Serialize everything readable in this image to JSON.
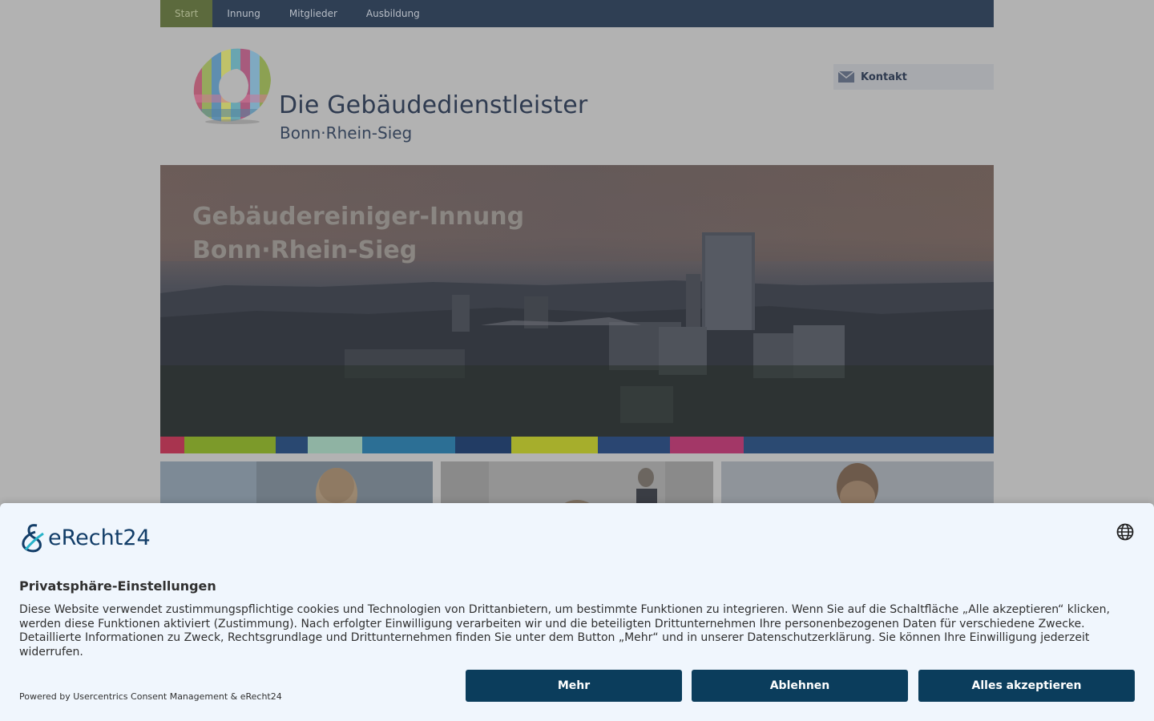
{
  "nav": {
    "items": [
      {
        "label": "Start",
        "active": true
      },
      {
        "label": "Innung"
      },
      {
        "label": "Mitglieder"
      },
      {
        "label": "Ausbildung"
      }
    ]
  },
  "header": {
    "title": "Die Gebäudedienstleister",
    "subtitle": "Bonn·Rhein-Sieg",
    "contact_label": "Kontakt",
    "contact_icon": "mail-icon"
  },
  "hero": {
    "title_line1": "Gebäudereiniger-Innung",
    "title_line2": "Bonn·Rhein-Sieg",
    "stripe_colors": [
      "#a8344f",
      "#7c9a2a",
      "#294871",
      "#8fb3a3",
      "#2c6f95",
      "#223c64",
      "#a6ae2c",
      "#2a4672",
      "#a33767",
      "#2b4a72"
    ]
  },
  "consent": {
    "brand": "eRecht24",
    "title": "Privatsphäre-Einstellungen",
    "description": "Diese Website verwendet zustimmungspflichtige cookies und Technologien von Drittanbietern, um bestimmte Funktionen zu integrieren. Wenn Sie auf die Schaltfläche „Alle akzeptieren“ klicken, werden diese Funktionen aktiviert (Zustimmung). Nach erfolgter Einwilligung verarbeiten wir und die beteiligten Drittunternehmen Ihre personenbezogenen Daten für verschiedene Zwecke. Detaillierte Informationen zu Zweck, Rechtsgrundlage und Drittunternehmen finden Sie unter dem Button „Mehr“ und in unserer Datenschutzerklärung. Sie können Ihre Einwilligung jederzeit widerrufen.",
    "powered_by": "Powered by Usercentrics Consent Management & eRecht24",
    "language_icon": "globe-icon",
    "buttons": {
      "more": "Mehr",
      "deny": "Ablehnen",
      "accept_all": "Alles akzeptieren"
    },
    "button_color": "#0b3d5c"
  }
}
